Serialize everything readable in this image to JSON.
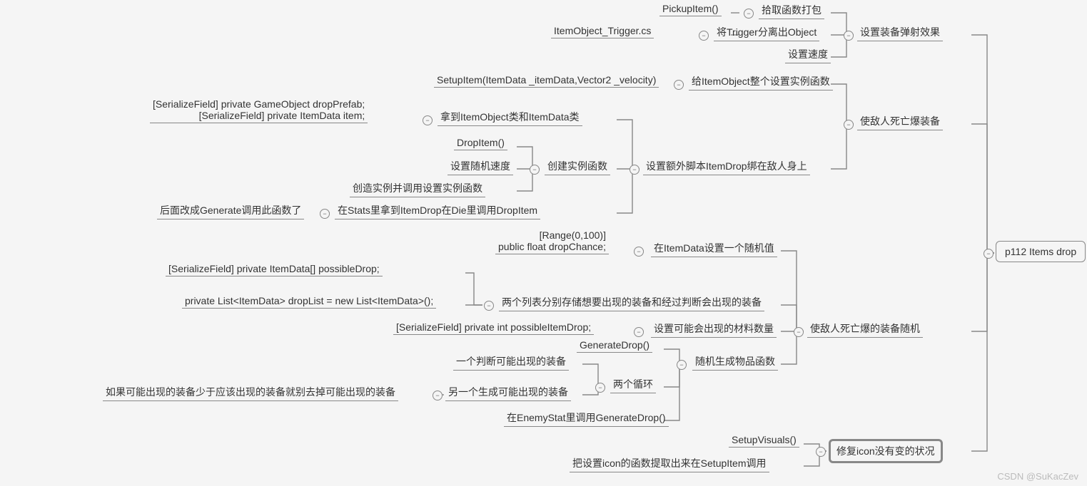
{
  "root": {
    "label": "p112 Items drop"
  },
  "branches": {
    "b1": {
      "label": "设置装备弹射效果",
      "children": {
        "c1": {
          "label": "拾取函数打包",
          "leaf": "PickupItem()"
        },
        "c2": {
          "label": "将Trigger分离出Object",
          "leaf": "ItemObject_Trigger.cs"
        },
        "c3": {
          "label": "设置速度"
        }
      }
    },
    "b2": {
      "label": "使敌人死亡爆装备",
      "children": {
        "c1": {
          "label": "给ItemObject整个设置实例函数",
          "leaf": "SetupItem(ItemData _itemData,Vector2 _velocity)"
        },
        "c2": {
          "label": "设置额外脚本ItemDrop绑在敌人身上",
          "children": {
            "d1": {
              "label": "拿到ItemObject类和ItemData类",
              "leaf": "[SerializeField] private GameObject dropPrefab;\n[SerializeField] private ItemData item;"
            },
            "d2": {
              "label": "创建实例函数",
              "children": {
                "e1": {
                  "label": "DropItem()"
                },
                "e2": {
                  "label": "设置随机速度"
                },
                "e3": {
                  "label": "创造实例并调用设置实例函数"
                }
              }
            },
            "d3": {
              "label": "在Stats里拿到ItemDrop在Die里调用DropItem",
              "leaf": "后面改成Generate调用此函数了"
            }
          }
        }
      }
    },
    "b3": {
      "label": "使敌人死亡爆的装备随机",
      "children": {
        "c1": {
          "label": "在ItemData设置一个随机值",
          "leaf": "[Range(0,100)]\npublic float dropChance;"
        },
        "c2": {
          "label": "两个列表分别存储想要出现的装备和经过判断会出现的装备",
          "children": {
            "d1": {
              "label": "[SerializeField] private ItemData[] possibleDrop;"
            },
            "d2": {
              "label": "private List<ItemData> dropList = new List<ItemData>();"
            }
          }
        },
        "c3": {
          "label": "设置可能会出现的材料数量",
          "leaf": "[SerializeField] private int possibleItemDrop;"
        },
        "c4": {
          "label": "随机生成物品函数",
          "children": {
            "d1": {
              "label": "GenerateDrop()"
            },
            "d2": {
              "label": "两个循环",
              "children": {
                "e1": {
                  "label": "一个判断可能出现的装备"
                },
                "e2": {
                  "label": "另一个生成可能出现的装备",
                  "leaf": "如果可能出现的装备少于应该出现的装备就别去掉可能出现的装备"
                }
              }
            },
            "d3": {
              "label": "在EnemyStat里调用GenerateDrop()"
            }
          }
        }
      }
    },
    "b4": {
      "label": "修复icon没有变的状况",
      "children": {
        "c1": {
          "label": "SetupVisuals()"
        },
        "c2": {
          "label": "把设置icon的函数提取出来在SetupItem调用"
        }
      }
    }
  },
  "watermark": "CSDN @SuKacZev"
}
